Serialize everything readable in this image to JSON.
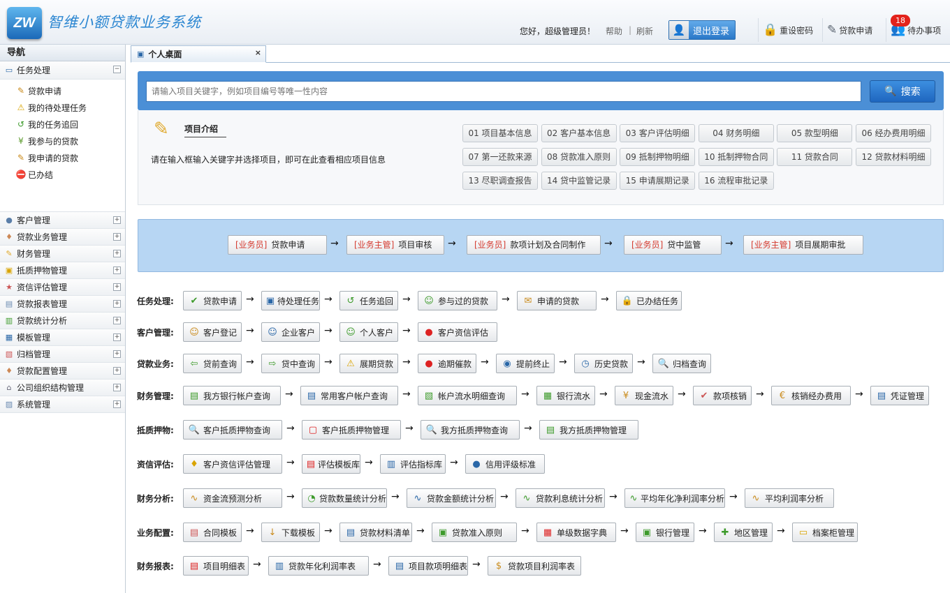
{
  "header": {
    "logo_text": "ZW",
    "app_title": "智维小额贷款业务系统",
    "greeting": "您好，超级管理员！",
    "help": "帮助",
    "sep": "|",
    "refresh": "刷新",
    "logout": "退出登录",
    "reset_password": "重设密码",
    "loan_apply": "贷款申请",
    "todo": "待办事项",
    "todo_count": "18"
  },
  "sidebar": {
    "title": "导航",
    "task_group": "任务处理",
    "task_items": [
      {
        "label": "贷款申请",
        "icon": "✎"
      },
      {
        "label": "我的待处理任务",
        "icon": "⚠"
      },
      {
        "label": "我的任务追回",
        "icon": "↺"
      },
      {
        "label": "我参与的贷款",
        "icon": "¥"
      },
      {
        "label": "我申请的贷款",
        "icon": "✎"
      },
      {
        "label": "已办结",
        "icon": "⛔"
      }
    ],
    "groups": [
      "客户管理",
      "贷款业务管理",
      "财务管理",
      "抵质押物管理",
      "资信评估管理",
      "贷款报表管理",
      "贷款统计分析",
      "模板管理",
      "归档管理",
      "贷款配置管理",
      "公司组织结构管理",
      "系统管理"
    ],
    "collapse": "−",
    "expand": "+"
  },
  "tabs": {
    "active": "个人桌面",
    "close": "×"
  },
  "search": {
    "placeholder": "请输入项目关键字，例如项目编号等唯一性内容",
    "button": "搜索"
  },
  "intro": {
    "title": "项目介绍",
    "desc": "请在输入框输入关键字并选择项目，即可在此查看相应项目信息",
    "buttons": [
      "01 项目基本信息",
      "02 客户基本信息",
      "03 客户评估明细",
      "04 财务明细",
      "05 款型明细",
      "06 经办费用明细",
      "07 第一还款来源",
      "08 贷款准入原则",
      "09 抵制押物明细",
      "10 抵制押物合同",
      "11 贷款合同",
      "12 贷款材料明细",
      "13 尽职调查报告",
      "14 贷中监管记录",
      "15 申请展期记录",
      "16 流程审批记录"
    ]
  },
  "flow": {
    "steps": [
      {
        "role": "[业务员]",
        "label": "贷款申请"
      },
      {
        "role": "[业务主管]",
        "label": "项目审核"
      },
      {
        "role": "[业务员]",
        "label": "款项计划及合同制作"
      },
      {
        "role": "[业务员]",
        "label": "贷中监管"
      },
      {
        "role": "[业务主管]",
        "label": "项目展期审批"
      }
    ],
    "arrow": "→"
  },
  "rows": [
    {
      "label": "任务处理:",
      "items": [
        "贷款申请",
        "待处理任务",
        "任务追回",
        "参与过的贷款",
        "申请的贷款",
        "已办结任务"
      ]
    },
    {
      "label": "客户管理:",
      "items": [
        "客户登记",
        "企业客户",
        "个人客户",
        "客户资信评估"
      ]
    },
    {
      "label": "贷款业务:",
      "items": [
        "贷前查询",
        "贷中查询",
        "展期贷款",
        "逾期催款",
        "提前终止",
        "历史贷款",
        "归档查询"
      ]
    },
    {
      "label": "财务管理:",
      "items": [
        "我方银行帐户查询",
        "常用客户帐户查询",
        "帐户流水明细查询",
        "银行流水",
        "现金流水",
        "款项核销",
        "核销经办费用",
        "凭证管理"
      ]
    },
    {
      "label": "抵质押物:",
      "items": [
        "客户抵质押物查询",
        "客户抵质押物管理",
        "我方抵质押物查询",
        "我方抵质押物管理"
      ]
    },
    {
      "label": "资信评估:",
      "items": [
        "客户资信评估管理",
        "评估模板库",
        "评估指标库",
        "信用评级标准"
      ]
    },
    {
      "label": "财务分析:",
      "items": [
        "资金流预测分析",
        "贷款数量统计分析",
        "贷款金额统计分析",
        "贷款利息统计分析",
        "平均年化净利润率分析",
        "平均利润率分析"
      ]
    },
    {
      "label": "业务配置:",
      "items": [
        "合同模板",
        "下载模板",
        "贷款材料清单",
        "贷款准入原则",
        "单级数据字典",
        "银行管理",
        "地区管理",
        "档案柜管理"
      ]
    },
    {
      "label": "财务报表:",
      "items": [
        "项目明细表",
        "贷款年化利润率表",
        "项目款项明细表",
        "贷款项目利润率表"
      ]
    }
  ]
}
